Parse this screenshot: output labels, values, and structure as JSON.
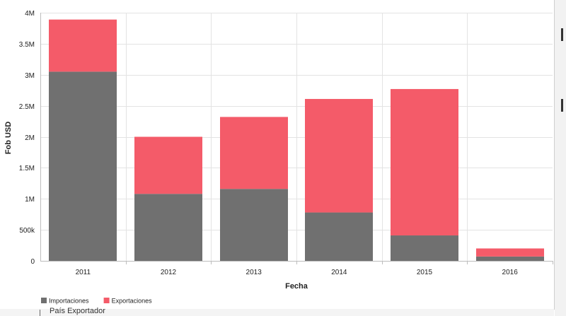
{
  "chart_data": {
    "type": "bar",
    "stacked": true,
    "categories": [
      "2011",
      "2012",
      "2013",
      "2014",
      "2015",
      "2016"
    ],
    "series": [
      {
        "name": "Importaciones",
        "color": "#707070",
        "values": [
          3050000,
          1080000,
          1160000,
          780000,
          410000,
          70000
        ]
      },
      {
        "name": "Exportaciones",
        "color": "#f45b69",
        "values": [
          840000,
          920000,
          1160000,
          1830000,
          2360000,
          130000
        ]
      }
    ],
    "xlabel": "Fecha",
    "ylabel": "Fob USD",
    "ylim": [
      0,
      4000000
    ],
    "yticks": [
      0,
      500000,
      1000000,
      1500000,
      2000000,
      2500000,
      3000000,
      3500000,
      4000000
    ],
    "ytick_labels": [
      "0",
      "500k",
      "1M",
      "1.5M",
      "2M",
      "2.5M",
      "3M",
      "3.5M",
      "4M"
    ],
    "grid": true,
    "legend_position": "bottom-left"
  },
  "below_chart": {
    "cutoff_label": "País Exportador"
  }
}
